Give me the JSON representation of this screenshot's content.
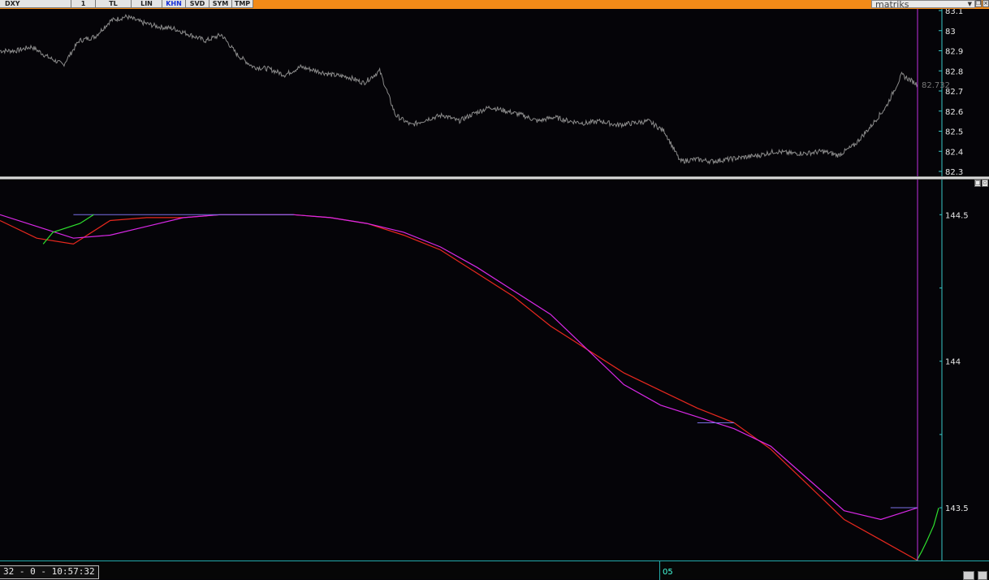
{
  "toolbar": {
    "symbol": "DXY",
    "interval": "1",
    "buttons": [
      "TL",
      "LIN",
      "KHN",
      "SVD",
      "SYM",
      "TMP"
    ],
    "active_button": "KHN",
    "brand": "matriks"
  },
  "status": {
    "clock": "32 - 0 - 10:57:32",
    "time_label": "05"
  },
  "colors": {
    "price": "#8a8a8a",
    "red_line": "#e8281e",
    "magenta_line": "#d828e6",
    "green_line": "#2ee02e",
    "flat_line": "#7b6fe6",
    "axis": "#38c8c8",
    "cursor": "#c030e0"
  },
  "chart_data": [
    {
      "type": "line",
      "panel": "top",
      "ylim": [
        82.3,
        83.1
      ],
      "yticks": [
        "83.1",
        "83",
        "82.9",
        "82.8",
        "82.7",
        "82.6",
        "82.5",
        "82.4",
        "82.3"
      ],
      "last_value_label": "82.732",
      "series": [
        {
          "values": [
            82.9,
            82.9,
            82.92,
            82.87,
            82.83,
            82.95,
            82.97,
            83.05,
            83.07,
            83.04,
            83.02,
            83.01,
            82.98,
            82.95,
            82.98,
            82.88,
            82.82,
            82.81,
            82.78,
            82.82,
            82.8,
            82.78,
            82.77,
            82.74,
            82.8,
            82.58,
            82.53,
            82.56,
            82.58,
            82.55,
            82.59,
            82.62,
            82.6,
            82.58,
            82.55,
            82.57,
            82.55,
            82.54,
            82.55,
            82.53,
            82.54,
            82.55,
            82.5,
            82.35,
            82.36,
            82.35,
            82.36,
            82.37,
            82.38,
            82.4,
            82.39,
            82.39,
            82.4,
            82.38,
            82.43,
            82.52,
            82.62,
            82.78,
            82.732
          ]
        }
      ]
    },
    {
      "type": "line",
      "panel": "bottom",
      "ylim": [
        143.32,
        144.62
      ],
      "yticks": [
        "144.5",
        "144",
        "143.5"
      ],
      "series": [
        {
          "color": "red",
          "values": [
            144.48,
            144.42,
            144.4,
            144.48,
            144.49,
            144.49,
            144.5,
            144.5,
            144.5,
            144.49,
            144.47,
            144.43,
            144.38,
            144.3,
            144.22,
            144.12,
            144.04,
            143.96,
            143.9,
            143.84,
            143.79,
            143.7,
            143.58,
            143.46,
            143.39,
            143.32
          ]
        },
        {
          "color": "magenta",
          "values": [
            144.5,
            144.46,
            144.42,
            144.43,
            144.46,
            144.49,
            144.5,
            144.5,
            144.5,
            144.49,
            144.47,
            144.44,
            144.39,
            144.32,
            144.24,
            144.16,
            144.04,
            143.92,
            143.85,
            143.81,
            143.77,
            143.71,
            143.6,
            143.49,
            143.46,
            143.5
          ]
        }
      ]
    }
  ]
}
